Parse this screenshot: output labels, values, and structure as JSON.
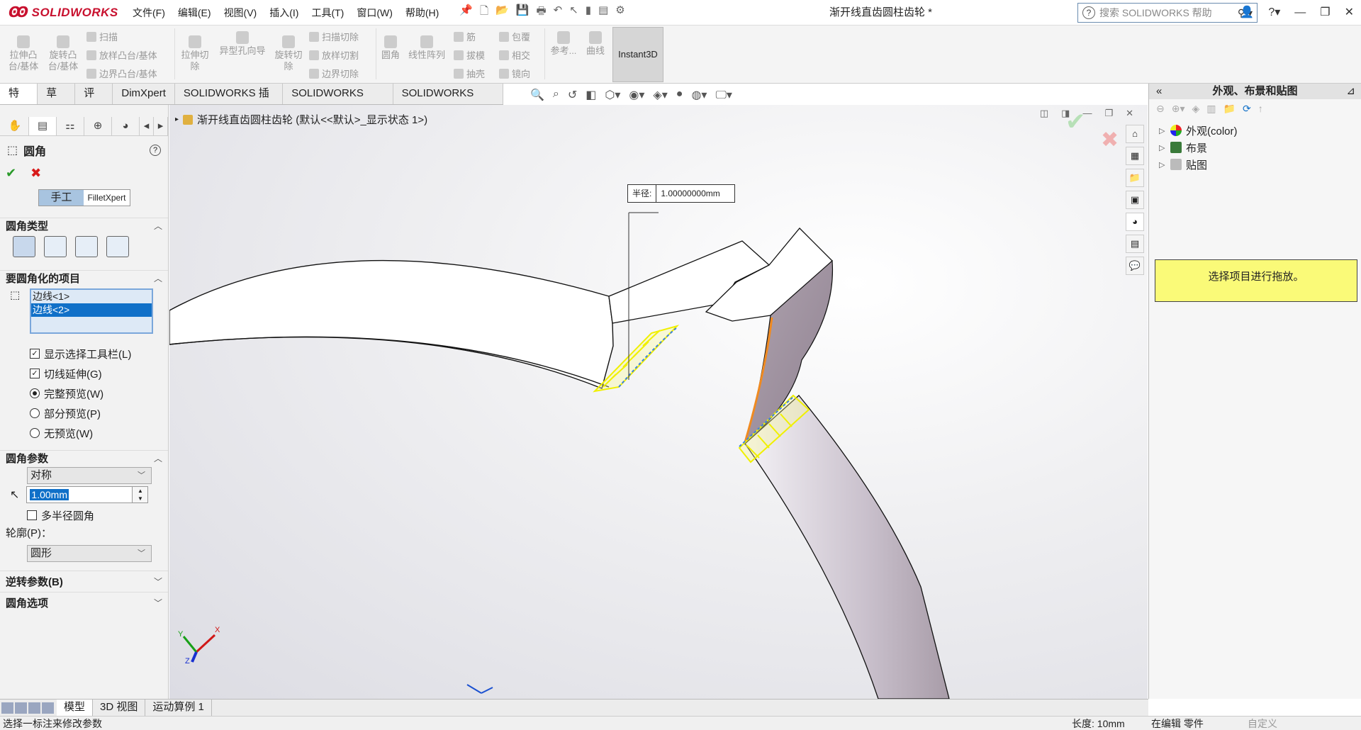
{
  "app": {
    "logo": "SOLIDWORKS",
    "doc_title": "渐开线直齿圆柱齿轮 *"
  },
  "menus": [
    "文件(F)",
    "编辑(E)",
    "视图(V)",
    "插入(I)",
    "工具(T)",
    "窗口(W)",
    "帮助(H)"
  ],
  "search": {
    "placeholder": "搜索 SOLIDWORKS 帮助"
  },
  "ribbon": {
    "extrude_boss": "拉伸凸\n台/基体",
    "revolve_boss": "旋转凸\n台/基体",
    "sweep": "扫描",
    "loft_boss": "放样凸台/基体",
    "boundary_boss": "边界凸台/基体",
    "extrude_cut": "拉伸切\n除",
    "hole_wizard": "异型孔向导",
    "revolve_cut": "旋转切\n除",
    "swept_cut": "扫描切除",
    "lofted_cut": "放样切割",
    "boundary_cut": "边界切除",
    "fillet": "圆角",
    "linear_pattern": "线性阵列",
    "rib": "筋",
    "draft": "拔模",
    "shell": "抽壳",
    "wrap": "包覆",
    "intersect": "相交",
    "mirror": "镜向",
    "reference": "参考...",
    "curves": "曲线",
    "instant3d": "Instant3D"
  },
  "tabs": [
    "特征",
    "草图",
    "评估",
    "DimXpert",
    "SOLIDWORKS 插件",
    "SOLIDWORKS MBD",
    "SOLIDWORKS CAM"
  ],
  "property_manager": {
    "title": "圆角",
    "mode_manual": "手工",
    "mode_xpert": "FilletXpert",
    "section_type": "圆角类型",
    "section_items": "要圆角化的项目",
    "edges": [
      "边线<1>",
      "边线<2>"
    ],
    "show_toolbar": "显示选择工具栏(L)",
    "tangent_prop": "切线延伸(G)",
    "full_preview": "完整预览(W)",
    "partial_preview": "部分预览(P)",
    "no_preview": "无预览(W)",
    "section_params": "圆角参数",
    "symmetric": "对称",
    "radius": "1.00mm",
    "multi_radius": "多半径圆角",
    "profile_label": "轮廓(P)：",
    "profile": "圆形",
    "section_setback": "逆转参数(B)",
    "section_options": "圆角选项"
  },
  "graphics": {
    "tree_label": "渐开线直齿圆柱齿轮 (默认<<默认>_显示状态 1>)",
    "dim_label": "半径:",
    "dim_value": "1.00000000mm",
    "triad_x": "X",
    "triad_y": "Y",
    "triad_z": "Z"
  },
  "task_pane": {
    "title": "外观、布景和贴图",
    "items": [
      "外观(color)",
      "布景",
      "贴图"
    ],
    "message": "选择项目进行拖放。"
  },
  "bottom_tabs": [
    "模型",
    "3D 视图",
    "运动算例 1"
  ],
  "status": {
    "message": "选择一标注来修改参数",
    "length": "长度: 10mm",
    "mode": "在编辑 零件",
    "custom": "自定义"
  },
  "colors": {
    "accent": "#1070c8",
    "preview_yellow": "#f0f000",
    "tooltip_bg": "#fafa78"
  }
}
